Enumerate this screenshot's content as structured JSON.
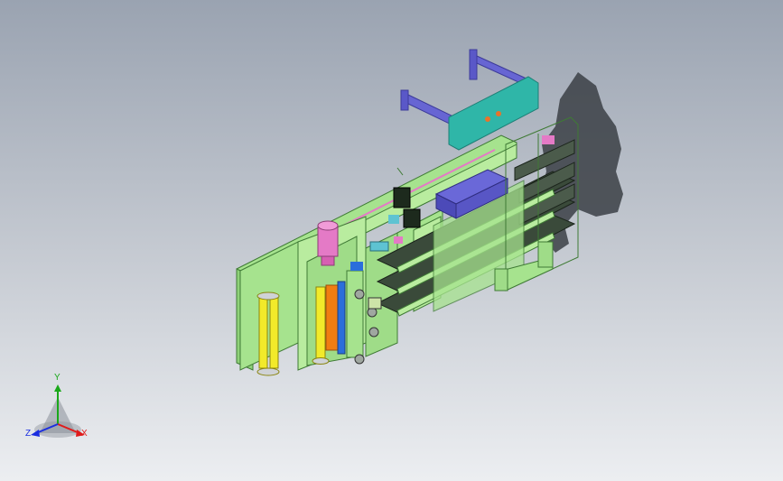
{
  "viewport": {
    "background_top": "#9aa3b1",
    "background_bottom": "#eceef1"
  },
  "model": {
    "colors": {
      "frame": "#a6e38e",
      "frame_dark": "#6fb85e",
      "belt": "#3a4a3a",
      "cylinder": "#f2ea2a",
      "orange_block": "#f07d12",
      "motor": "#e47ac6",
      "gear_motor": "#1d2a1d",
      "cyan_plate": "#2fb6a8",
      "blue_rods": "#5a58c8",
      "shadow": "#3b3f45"
    }
  },
  "triad": {
    "x_label": "X",
    "y_label": "Y",
    "z_label": "Z",
    "x_color": "#e01b1b",
    "y_color": "#1aa81a",
    "z_color": "#1b2ee0"
  }
}
